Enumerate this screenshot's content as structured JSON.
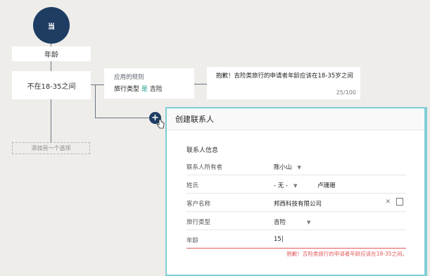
{
  "tree": {
    "root_label": "当",
    "age_node": "年龄",
    "range_node": "不在18-35之间",
    "rule": {
      "title": "应用的规则",
      "field": "旅行类型",
      "operator": "是",
      "value": "吉险"
    },
    "message": {
      "text": "抱歉！吉险类旅行的申请者年龄应该在18-35岁之间",
      "count": "25/100"
    },
    "add_option": "添加另一个选项"
  },
  "modal": {
    "title": "创建联系人",
    "section": "联系人信息",
    "fields": [
      {
        "label": "联系人所有者",
        "value": "陈小山"
      },
      {
        "label": "姓氏",
        "value": "- 无 -",
        "value2": "卢珊珊"
      },
      {
        "label": "客户名称",
        "value": "邦西科技有限公司"
      },
      {
        "label": "旅行类型",
        "value": "吉险"
      },
      {
        "label": "年龄",
        "value": "15|"
      }
    ],
    "error": "抱歉！吉险类旅行的申请者年龄应该在18-35之间。"
  },
  "colors": {
    "primary": "#1f3d63",
    "accent": "#7fcfd6",
    "error": "#e05a5a",
    "operator": "#1c9c8a"
  }
}
